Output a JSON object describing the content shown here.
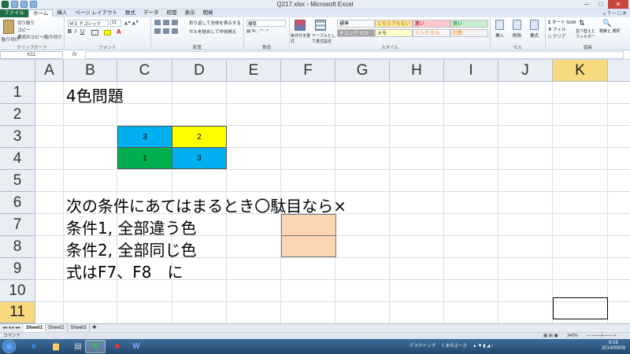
{
  "window": {
    "title": "Q217.xlsx - Microsoft Excel",
    "controls": {
      "minimize": "─",
      "maximize": "□",
      "close": "✕"
    }
  },
  "ribbon_tabs": [
    "ファイル",
    "ホーム",
    "挿入",
    "ページ レイアウト",
    "数式",
    "データ",
    "校閲",
    "表示",
    "開発"
  ],
  "ribbon": {
    "clipboard": {
      "cut": "切り取り",
      "copy": "コピー",
      "format_painter": "書式のコピー/貼り付け",
      "paste": "貼り付け",
      "label": "クリップボード"
    },
    "font": {
      "name": "ＭＳ Ｐゴシック",
      "size": "11",
      "label": "フォント"
    },
    "alignment": {
      "wrap": "折り返して全体を表示する",
      "merge": "セルを結合して中央揃え",
      "label": "配置"
    },
    "number": {
      "format": "標準",
      "label": "数値"
    },
    "styles": {
      "cond_format": "条件付き書式",
      "table_format": "テーブルとして書式設定",
      "cell_styles": [
        {
          "name": "標準",
          "bg": "#ffffff",
          "fg": "#000000"
        },
        {
          "name": "どちらでもない",
          "bg": "#ffeb9c",
          "fg": "#9c6500"
        },
        {
          "name": "悪い",
          "bg": "#ffc7ce",
          "fg": "#9c0006"
        },
        {
          "name": "良い",
          "bg": "#c6efce",
          "fg": "#006100"
        },
        {
          "name": "チェック セル",
          "bg": "#a5a5a5",
          "fg": "#ffffff"
        },
        {
          "name": "メモ",
          "bg": "#ffffcc",
          "fg": "#000000"
        },
        {
          "name": "リンク セル",
          "bg": "#ffffff",
          "fg": "#fa7d00"
        },
        {
          "name": "計算",
          "bg": "#f2f2f2",
          "fg": "#fa7d00"
        }
      ],
      "label": "スタイル"
    },
    "cells": {
      "insert": "挿入",
      "delete": "削除",
      "format": "書式",
      "label": "セル"
    },
    "editing": {
      "autosum": "オート SUM",
      "fill": "フィル",
      "clear": "クリア",
      "sort_filter": "並べ替えと フィルター",
      "find_select": "検索と 選択",
      "label": "編集"
    }
  },
  "formula_bar": {
    "name_box": "K11",
    "fx": "fx",
    "formula": ""
  },
  "columns": [
    "A",
    "B",
    "C",
    "D",
    "E",
    "F",
    "G",
    "H",
    "I",
    "J",
    "K"
  ],
  "rows": [
    "1",
    "2",
    "3",
    "4",
    "5",
    "6",
    "7",
    "8",
    "9",
    "10",
    "11"
  ],
  "selected_cell": "K11",
  "cells": {
    "B1": "4色問題",
    "C3": "3",
    "D3": "2",
    "C4": "1",
    "D4": "3",
    "B6": "次の条件にあてはまるとき〇駄目なら×",
    "B7": "条件1, 全部違う色",
    "B8": "条件2, 全部同じ色",
    "B9": "式はF7、F8　に"
  },
  "fills": {
    "C3": "#00b0f0",
    "D3": "#ffff00",
    "C4": "#00b050",
    "D4": "#00b0f0",
    "F7": "#fcd5b4",
    "F8": "#fcd5b4"
  },
  "sheets": [
    "Sheet1",
    "Sheet2",
    "Sheet3"
  ],
  "active_sheet": "Sheet1",
  "status": {
    "mode": "コマンド",
    "zoom": "340%"
  },
  "taskbar": {
    "desktop": "デスクトップ",
    "app2": "くまのぷーさ",
    "time": "6:16",
    "date": "2014/09/09"
  }
}
